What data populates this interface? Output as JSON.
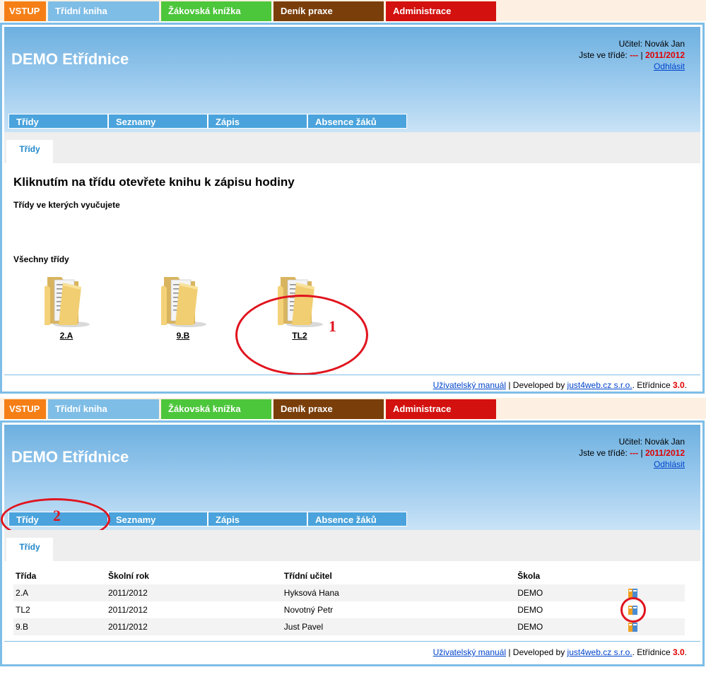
{
  "topnav": {
    "vstup": "VSTUP",
    "tridni_kniha": "Třídní kniha",
    "zakovska": "Žákovská knížka",
    "denik": "Deník praxe",
    "admin": "Administrace"
  },
  "header": {
    "title": "DEMO Etřídnice",
    "teacher": "Učitel: Novák Jan",
    "class_prefix": "Jste ve třídě:",
    "class_value": "---",
    "separator": "|",
    "year": "2011/2012",
    "logout": "Odhlásit"
  },
  "subnav": [
    "Třídy",
    "Seznamy",
    "Zápis",
    "Absence žáků"
  ],
  "tab_active": "Třídy",
  "screen1": {
    "heading": "Kliknutím na třídu otevřete knihu k zápisu hodiny",
    "section_teaching": "Třídy ve kterých vyučujete",
    "section_all": "Všechny třídy",
    "folders": [
      "2.A",
      "9.B",
      "TL2"
    ],
    "annotation": "1"
  },
  "screen2": {
    "annotation": "2",
    "table": {
      "headers": [
        "Třída",
        "Školní rok",
        "Třídní učitel",
        "Škola"
      ],
      "rows": [
        [
          "2.A",
          "2011/2012",
          "Hyksová Hana",
          "DEMO"
        ],
        [
          "TL2",
          "2011/2012",
          "Novotný Petr",
          "DEMO"
        ],
        [
          "9.B",
          "2011/2012",
          "Just Pavel",
          "DEMO"
        ]
      ]
    }
  },
  "footer": {
    "manual": "Uživatelský manuál",
    "developed": "| Developed by",
    "company": "just4web.cz s.r.o.",
    "product": ". Etřídnice",
    "version": "3.0",
    "dot": "."
  },
  "colors": {
    "vstup": "#f57f16",
    "tridni_kniha": "#7ebde6",
    "zakovska": "#4cc63b",
    "denik": "#7a3e0a",
    "admin": "#d3110e",
    "annotation": "#e0141e"
  }
}
